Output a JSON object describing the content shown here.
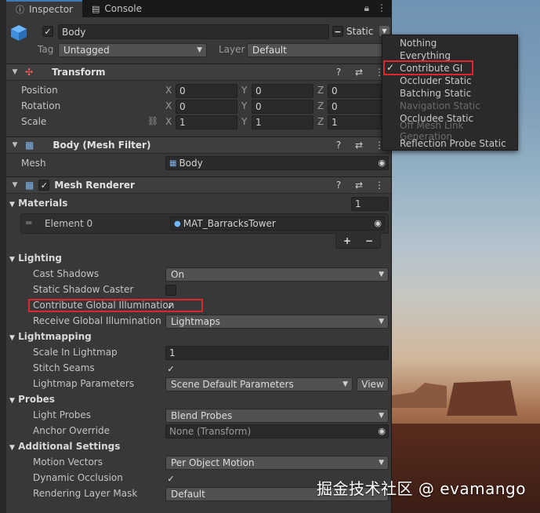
{
  "tabs": {
    "inspector": "Inspector",
    "console": "Console"
  },
  "object": {
    "name": "Body",
    "static_label": "Static",
    "tag_label": "Tag",
    "tag_value": "Untagged",
    "layer_label": "Layer",
    "layer_value": "Default"
  },
  "transform": {
    "title": "Transform",
    "position_label": "Position",
    "rotation_label": "Rotation",
    "scale_label": "Scale",
    "axis_x": "X",
    "axis_y": "Y",
    "axis_z": "Z",
    "position": {
      "x": "0",
      "y": "0",
      "z": "0"
    },
    "rotation": {
      "x": "0",
      "y": "0",
      "z": "0"
    },
    "scale": {
      "x": "1",
      "y": "1",
      "z": "1"
    }
  },
  "mesh_filter": {
    "title": "Body (Mesh Filter)",
    "mesh_label": "Mesh",
    "mesh_value": "Body"
  },
  "mesh_renderer": {
    "title": "Mesh Renderer",
    "materials_label": "Materials",
    "materials_count": "1",
    "element_label": "Element 0",
    "element_value": "MAT_BarracksTower",
    "plus": "+",
    "minus": "−",
    "lighting": "Lighting",
    "cast_shadows_label": "Cast Shadows",
    "cast_shadows_value": "On",
    "static_shadow_label": "Static Shadow Caster",
    "contribute_gi_label": "Contribute Global Illumination",
    "receive_gi_label": "Receive Global Illumination",
    "receive_gi_value": "Lightmaps",
    "lightmapping": "Lightmapping",
    "scale_in_lightmap_label": "Scale In Lightmap",
    "scale_in_lightmap_value": "1",
    "stitch_seams_label": "Stitch Seams",
    "lightmap_params_label": "Lightmap Parameters",
    "lightmap_params_value": "Scene Default Parameters",
    "view_button": "View",
    "probes": "Probes",
    "light_probes_label": "Light Probes",
    "light_probes_value": "Blend Probes",
    "anchor_override_label": "Anchor Override",
    "anchor_override_value": "None (Transform)",
    "additional": "Additional Settings",
    "motion_vectors_label": "Motion Vectors",
    "motion_vectors_value": "Per Object Motion",
    "dynamic_occlusion_label": "Dynamic Occlusion",
    "rendering_layer_label": "Rendering Layer Mask",
    "rendering_layer_value": "Default"
  },
  "static_menu": {
    "items": [
      {
        "label": "Nothing",
        "checked": false,
        "disabled": false
      },
      {
        "label": "Everything",
        "checked": false,
        "disabled": false
      },
      {
        "label": "Contribute GI",
        "checked": true,
        "disabled": false
      },
      {
        "label": "Occluder Static",
        "checked": false,
        "disabled": false
      },
      {
        "label": "Batching Static",
        "checked": false,
        "disabled": false
      },
      {
        "label": "Navigation Static",
        "checked": false,
        "disabled": true
      },
      {
        "label": "Occludee Static",
        "checked": false,
        "disabled": false
      },
      {
        "label": "Off Mesh Link Generation",
        "checked": false,
        "disabled": true
      },
      {
        "label": "Reflection Probe Static",
        "checked": false,
        "disabled": false
      }
    ]
  },
  "watermark": "掘金技术社区 @ evamango",
  "colors": {
    "highlight_red": "#e0262b",
    "accent_blue": "#3a79bb"
  }
}
